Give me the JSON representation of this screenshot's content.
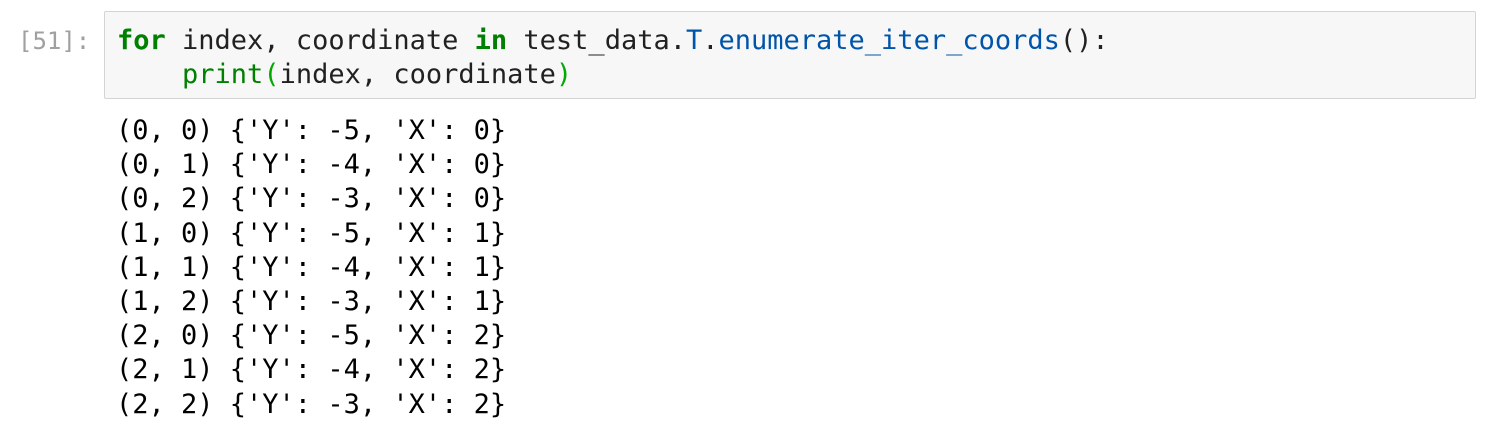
{
  "cell": {
    "prompt": "[51]:",
    "code": {
      "line1": {
        "kw_for": "for",
        "seg1": " index, coordinate ",
        "kw_in": "in",
        "seg2": " test_data.",
        "attr_T": "T",
        "dot": ".",
        "method": "enumerate_iter_coords",
        "call_end": "():"
      },
      "line2": {
        "indent": "    ",
        "func": "print",
        "open_paren": "(",
        "args": "index, coordinate",
        "close_paren": ")"
      }
    },
    "output_lines": [
      "(0, 0) {'Y': -5, 'X': 0}",
      "(0, 1) {'Y': -4, 'X': 0}",
      "(0, 2) {'Y': -3, 'X': 0}",
      "(1, 0) {'Y': -5, 'X': 1}",
      "(1, 1) {'Y': -4, 'X': 1}",
      "(1, 2) {'Y': -3, 'X': 1}",
      "(2, 0) {'Y': -5, 'X': 2}",
      "(2, 1) {'Y': -4, 'X': 2}",
      "(2, 2) {'Y': -3, 'X': 2}"
    ],
    "colors": {
      "keyword": "#008000",
      "attribute": "#0055aa",
      "prompt": "#a0a0a0",
      "input_background": "#f7f7f7",
      "input_border": "#d4d4d4"
    }
  }
}
